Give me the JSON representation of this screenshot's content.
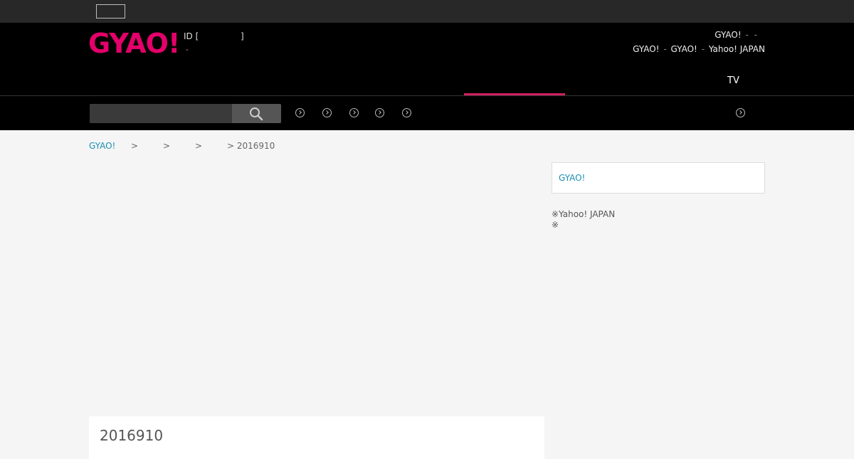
{
  "topbar": {},
  "header": {
    "logo": "GYAO!",
    "login_prefix": "ID [",
    "login_suffix": "]",
    "login_dash": "-",
    "right_line1": {
      "text": "GYAO!",
      "sep1": "-",
      "sep2": "-"
    },
    "right_line2": {
      "a": "GYAO!",
      "sep1": "-",
      "b": "GYAO!",
      "sep2": "-",
      "c": "Yahoo! JAPAN"
    },
    "nav_tv": "TV"
  },
  "search": {
    "placeholder": "",
    "icon": "search-icon"
  },
  "nav_circles": [
    "chevron-circle-icon",
    "chevron-circle-icon",
    "chevron-circle-icon",
    "chevron-circle-icon",
    "chevron-circle-icon",
    "chevron-circle-icon"
  ],
  "breadcrumb": {
    "home": "GYAO!",
    "arrow": ">",
    "current": "> 2016910"
  },
  "sidebar": {
    "box_link": "GYAO!",
    "note1": "※Yahoo! JAPAN",
    "note2": "※"
  },
  "main": {
    "title": "2016910"
  },
  "colors": {
    "brand": "#e4006a",
    "link": "#1a8fb3",
    "header_bg": "#000000",
    "topbar_bg": "#282828",
    "accent_underline": "#d0205e"
  }
}
